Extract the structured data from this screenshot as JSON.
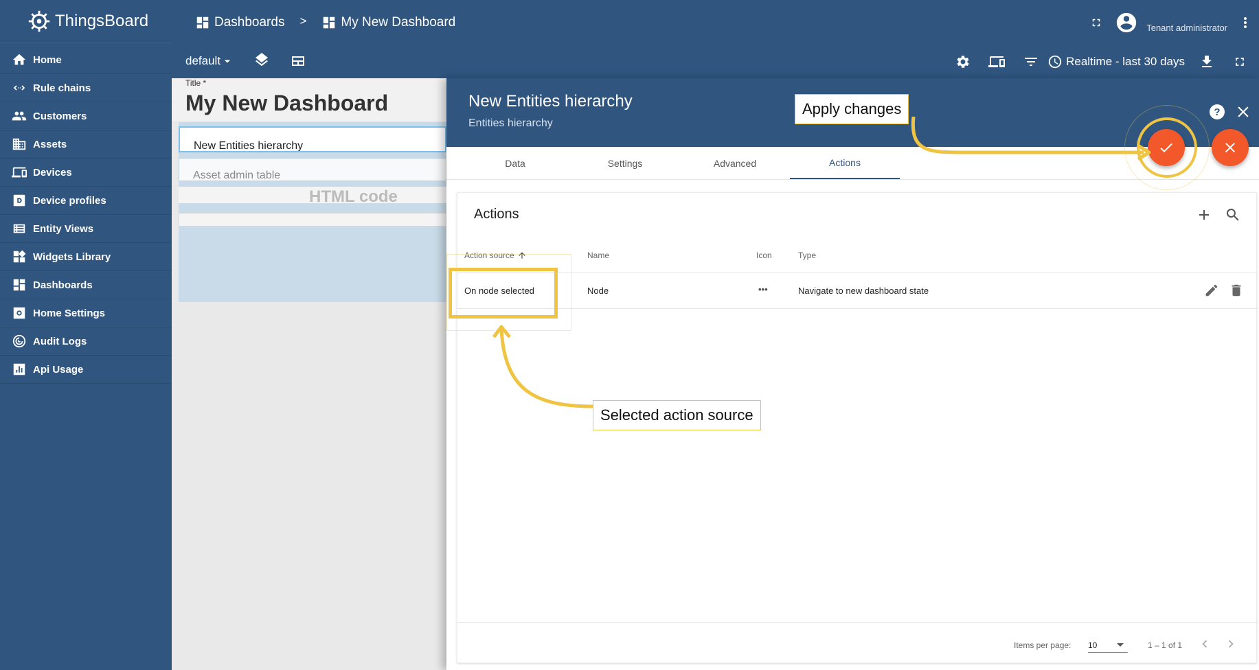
{
  "app": {
    "name": "ThingsBoard"
  },
  "sidebar": {
    "items": [
      {
        "label": "Home",
        "icon": "home-icon"
      },
      {
        "label": "Rule chains",
        "icon": "rule-chains-icon"
      },
      {
        "label": "Customers",
        "icon": "customers-icon"
      },
      {
        "label": "Assets",
        "icon": "assets-icon"
      },
      {
        "label": "Devices",
        "icon": "devices-icon"
      },
      {
        "label": "Device profiles",
        "icon": "device-profiles-icon"
      },
      {
        "label": "Entity Views",
        "icon": "entity-views-icon"
      },
      {
        "label": "Widgets Library",
        "icon": "widgets-library-icon"
      },
      {
        "label": "Dashboards",
        "icon": "dashboards-icon"
      },
      {
        "label": "Home Settings",
        "icon": "home-settings-icon"
      },
      {
        "label": "Audit Logs",
        "icon": "audit-logs-icon"
      },
      {
        "label": "Api Usage",
        "icon": "api-usage-icon"
      }
    ]
  },
  "topbar": {
    "breadcrumb": [
      "Dashboards",
      ">",
      "My New Dashboard"
    ],
    "user_role": "Tenant administrator"
  },
  "dashboard_toolbar": {
    "state": "default",
    "timewindow": "Realtime - last 30 days"
  },
  "dashboard": {
    "title_label": "Title *",
    "title": "My New Dashboard",
    "widgets": [
      "New Entities hierarchy",
      "Asset admin table",
      "HTML code"
    ]
  },
  "editor": {
    "title": "New Entities hierarchy",
    "subtitle": "Entities hierarchy",
    "help": "?",
    "tabs": [
      "Data",
      "Settings",
      "Advanced",
      "Actions"
    ],
    "active_tab": "Actions",
    "actions": {
      "heading": "Actions",
      "columns": {
        "source": "Action source",
        "name": "Name",
        "icon": "Icon",
        "type": "Type"
      },
      "rows": [
        {
          "source": "On node selected",
          "name": "Node",
          "icon": "•••",
          "type": "Navigate to new dashboard state"
        }
      ],
      "paginator": {
        "label": "Items per page:",
        "page_size": "10",
        "range": "1 – 1 of 1"
      }
    }
  },
  "annotations": {
    "apply": "Apply changes",
    "selected": "Selected action source"
  },
  "colors": {
    "primary": "#305680",
    "accent": "#f2582a",
    "highlight": "#efc443"
  }
}
